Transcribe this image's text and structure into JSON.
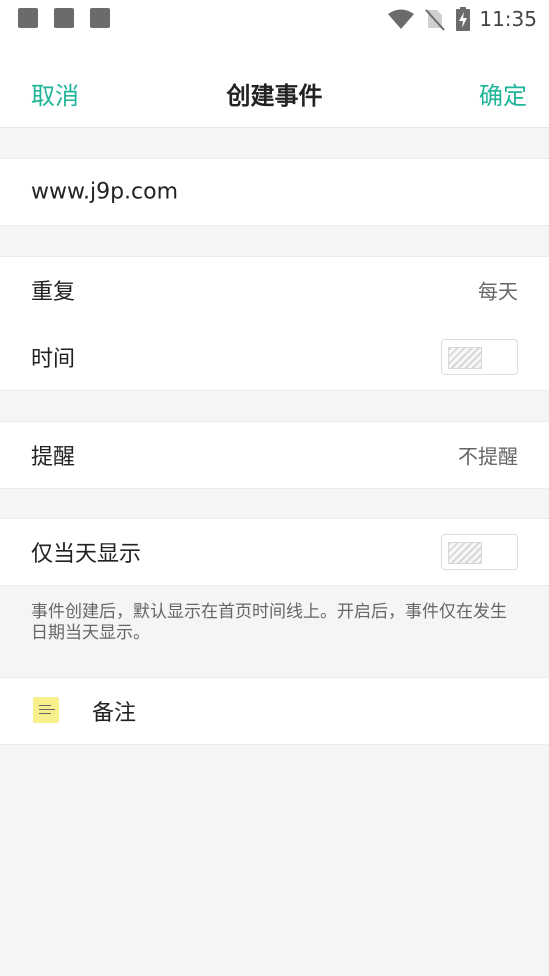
{
  "status_bar": {
    "time": "11:35",
    "left_icons": [
      "notification-square-icon",
      "notification-square-icon",
      "notification-square-icon"
    ],
    "right_icons": [
      "wifi-icon",
      "no-sim-icon",
      "battery-charging-icon"
    ]
  },
  "nav": {
    "cancel": "取消",
    "title": "创建事件",
    "confirm": "确定"
  },
  "event": {
    "title": "www.j9p.com"
  },
  "repeat": {
    "label": "重复",
    "value": "每天"
  },
  "time": {
    "label": "时间",
    "toggle_on": false
  },
  "remind": {
    "label": "提醒",
    "value": "不提醒"
  },
  "today_only": {
    "label": "仅当天显示",
    "toggle_on": false
  },
  "hint": "事件创建后，默认显示在首页时间线上。开启后，事件仅在发生日期当天显示。",
  "note": {
    "label": "备注",
    "icon": "note-icon"
  },
  "colors": {
    "accent": "#1fb59a",
    "background": "#f5f5f5",
    "card": "#ffffff",
    "note_icon": "#f7f08d"
  }
}
